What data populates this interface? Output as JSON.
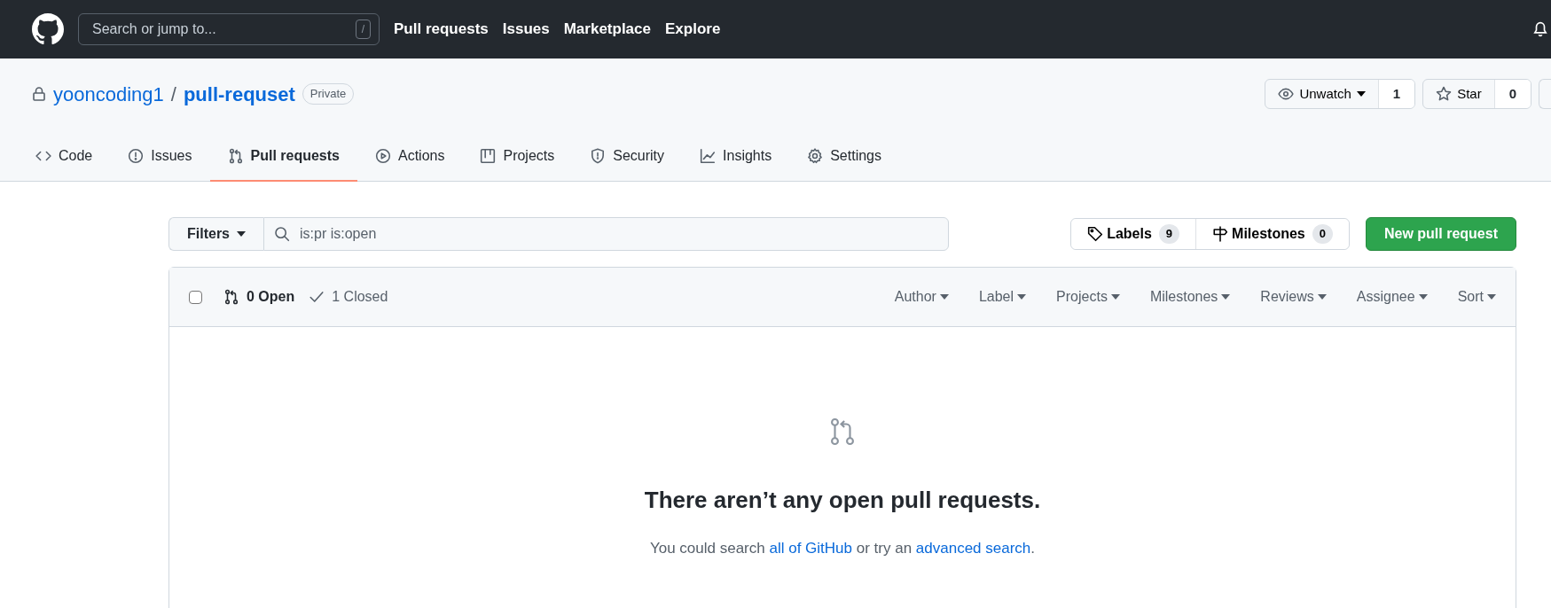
{
  "top_bar": {
    "search": {
      "placeholder": "Search or jump to...",
      "shortcut": "/"
    },
    "links": [
      {
        "label": "Pull requests"
      },
      {
        "label": "Issues"
      },
      {
        "label": "Marketplace"
      },
      {
        "label": "Explore"
      }
    ]
  },
  "repo": {
    "owner": "yooncoding1",
    "separator": "/",
    "name": "pull-requset",
    "visibility": "Private",
    "actions": [
      {
        "kind": "watch",
        "label": "Unwatch",
        "count": "1"
      },
      {
        "kind": "star",
        "label": "Star",
        "count": "0"
      }
    ]
  },
  "tabs": [
    {
      "kind": "code",
      "label": "Code",
      "selected": false
    },
    {
      "kind": "issues",
      "label": "Issues",
      "selected": false
    },
    {
      "kind": "pr",
      "label": "Pull requests",
      "selected": true
    },
    {
      "kind": "actions",
      "label": "Actions",
      "selected": false
    },
    {
      "kind": "projects",
      "label": "Projects",
      "selected": false
    },
    {
      "kind": "security",
      "label": "Security",
      "selected": false
    },
    {
      "kind": "insights",
      "label": "Insights",
      "selected": false
    },
    {
      "kind": "settings",
      "label": "Settings",
      "selected": false
    }
  ],
  "filter_bar": {
    "filters": "Filters",
    "query": "is:pr is:open",
    "labels": {
      "label": "Labels",
      "count": "9"
    },
    "milestones": {
      "label": "Milestones",
      "count": "0"
    },
    "new_button": "New pull request"
  },
  "list_header": {
    "select_all": {
      "checked": false
    },
    "states": [
      {
        "kind": "open",
        "label": "0 Open",
        "selected": true
      },
      {
        "kind": "closed",
        "label": "1 Closed",
        "selected": false
      }
    ],
    "sorters": [
      {
        "label": "Author"
      },
      {
        "label": "Label"
      },
      {
        "label": "Projects"
      },
      {
        "label": "Milestones"
      },
      {
        "label": "Reviews"
      },
      {
        "label": "Assignee"
      },
      {
        "label": "Sort"
      }
    ]
  },
  "empty_state": {
    "title": "There aren’t any open pull requests.",
    "message": [
      {
        "kind": "text",
        "text": "You could search "
      },
      {
        "kind": "link",
        "text": "all of GitHub"
      },
      {
        "kind": "text",
        "text": " or try an "
      },
      {
        "kind": "link",
        "text": "advanced search"
      },
      {
        "kind": "text",
        "text": "."
      }
    ]
  }
}
